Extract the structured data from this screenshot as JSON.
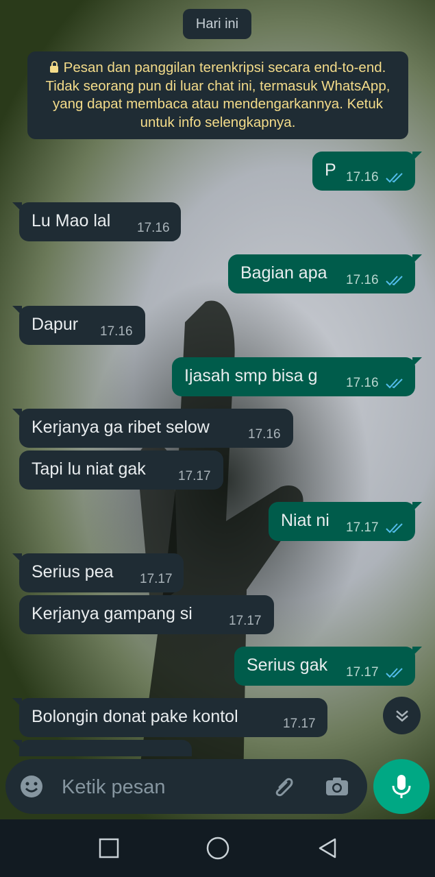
{
  "date_chip": "Hari ini",
  "encryption_notice": "Pesan dan panggilan terenkripsi secara end-to-end. Tidak seorang pun di luar chat ini, termasuk WhatsApp, yang dapat membaca atau mendengarkannya. Ketuk untuk info selengkapnya.",
  "messages": [
    {
      "direction": "out",
      "text": "P",
      "time": "17.16",
      "status": "read"
    },
    {
      "direction": "in",
      "text": "Lu Mao lal",
      "time": "17.16"
    },
    {
      "direction": "out",
      "text": "Bagian apa",
      "time": "17.16",
      "status": "read"
    },
    {
      "direction": "in",
      "text": "Dapur",
      "time": "17.16"
    },
    {
      "direction": "out",
      "text": "Ijasah smp bisa g",
      "time": "17.16",
      "status": "read"
    },
    {
      "direction": "in",
      "text": "Kerjanya ga ribet selow",
      "time": "17.16"
    },
    {
      "direction": "in",
      "text": "Tapi lu niat gak",
      "time": "17.17"
    },
    {
      "direction": "out",
      "text": "Niat ni",
      "time": "17.17",
      "status": "read"
    },
    {
      "direction": "in",
      "text": "Serius pea",
      "time": "17.17"
    },
    {
      "direction": "in",
      "text": "Kerjanya gampang si",
      "time": "17.17"
    },
    {
      "direction": "out",
      "text": "Serius gak",
      "time": "17.17",
      "status": "read"
    },
    {
      "direction": "in",
      "text": "Bolongin donat pake kontol",
      "time": "17.17"
    }
  ],
  "composer": {
    "placeholder": "Ketik pesan"
  },
  "icons": {
    "emoji": "emoji-icon",
    "attach": "paperclip-icon",
    "camera": "camera-icon",
    "mic": "microphone-icon",
    "scroll": "double-chevron-down-icon",
    "nav_recents": "square-icon",
    "nav_home": "circle-icon",
    "nav_back": "triangle-back-icon",
    "read_receipt": "double-check-icon"
  },
  "colors": {
    "incoming_bubble": "#1f2c34",
    "outgoing_bubble": "#005c4b",
    "accent": "#00a884",
    "read_tick": "#53bdeb",
    "notice_text": "#f4dc8a"
  }
}
